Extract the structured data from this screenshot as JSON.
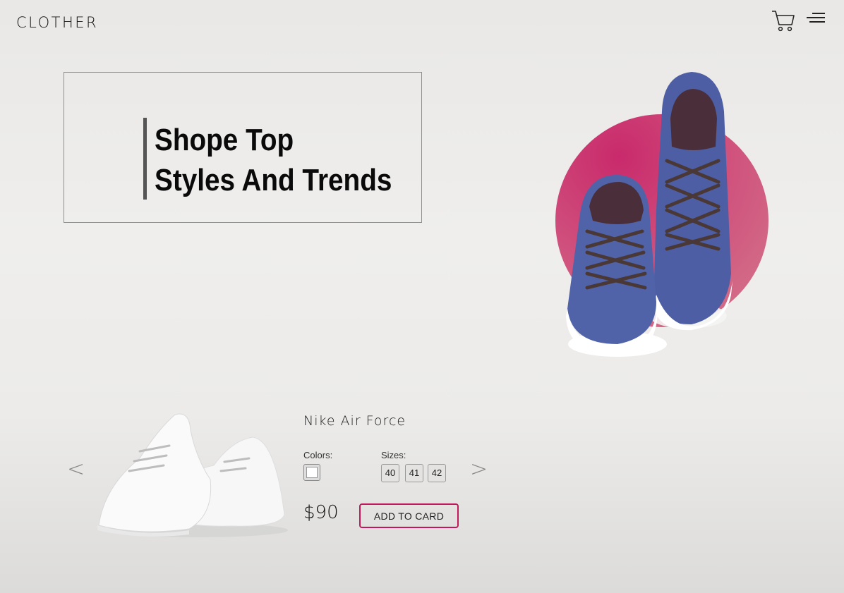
{
  "header": {
    "logo": "CLOTHER",
    "icons": [
      "cart-icon",
      "menu-icon"
    ]
  },
  "hero": {
    "title_line1": "Shope Top",
    "title_line2": "Styles And Trends"
  },
  "colors": {
    "accent": "#c2185b",
    "circle_start": "#c92a6b",
    "circle_end": "#d4788c",
    "shoe_blue": "#4f5fa3",
    "background": "#ecebe9"
  },
  "product": {
    "prev_arrow": "<",
    "next_arrow": ">",
    "name": "Nike Air Force",
    "colors_label": "Colors:",
    "sizes_label": "Sizes:",
    "color_options": [
      "white"
    ],
    "sizes": [
      "40",
      "41",
      "42"
    ],
    "price": "$90",
    "add_button": "ADD TO CARD"
  }
}
